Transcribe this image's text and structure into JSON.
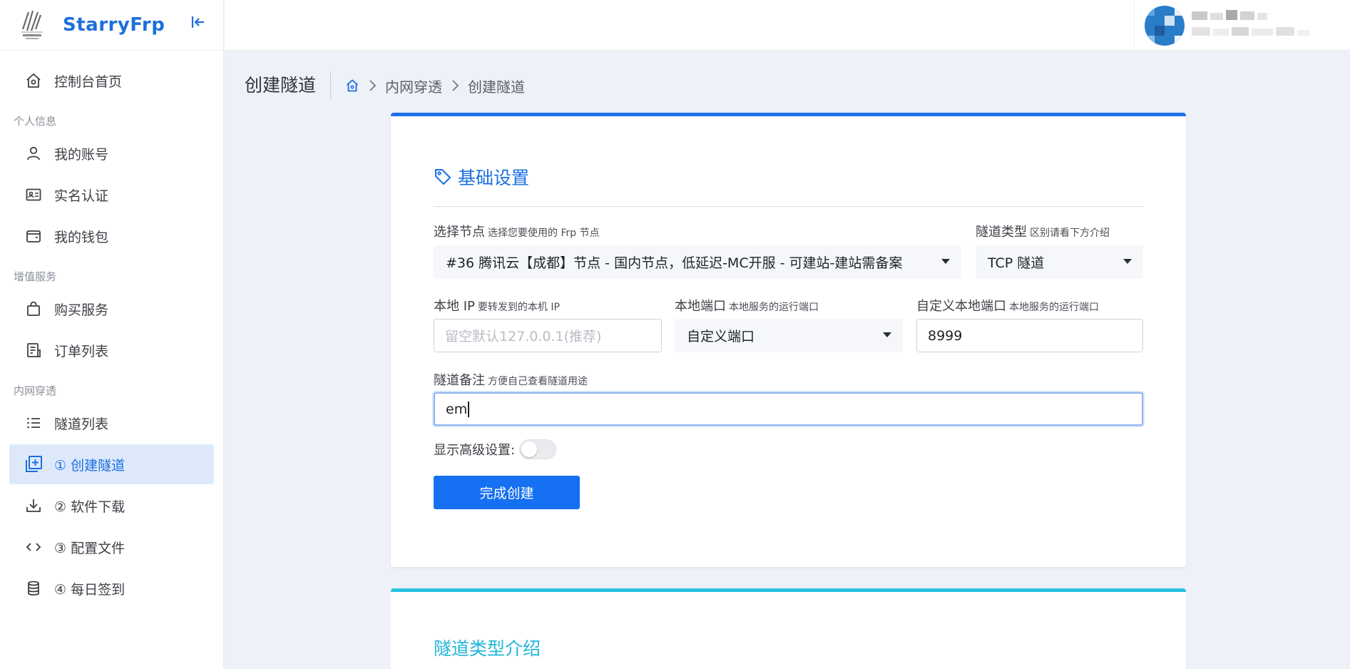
{
  "brand": {
    "name": "StarryFrp"
  },
  "sidebar": {
    "items": [
      {
        "label": "控制台首页",
        "icon": "home-icon"
      },
      {
        "section": "个人信息"
      },
      {
        "label": "我的账号",
        "icon": "user-icon"
      },
      {
        "label": "实名认证",
        "icon": "id-card-icon"
      },
      {
        "label": "我的钱包",
        "icon": "wallet-icon"
      },
      {
        "section": "增值服务"
      },
      {
        "label": "购买服务",
        "icon": "shopping-bag-icon"
      },
      {
        "label": "订单列表",
        "icon": "order-list-icon"
      },
      {
        "section": "内网穿透"
      },
      {
        "label": "隧道列表",
        "icon": "list-icon"
      },
      {
        "label": "① 创建隧道",
        "icon": "add-square-icon",
        "active": true
      },
      {
        "label": "② 软件下载",
        "icon": "download-icon"
      },
      {
        "label": "③ 配置文件",
        "icon": "code-icon"
      },
      {
        "label": "④ 每日签到",
        "icon": "database-icon"
      }
    ]
  },
  "header": {
    "user": {
      "name": "",
      "sub": ""
    }
  },
  "page": {
    "title": "创建隧道",
    "breadcrumb": [
      "内网穿透",
      "创建隧道"
    ]
  },
  "form": {
    "section_title": "基础设置",
    "node": {
      "label": "选择节点",
      "hint": "选择您要使用的 Frp 节点",
      "value": "#36 腾讯云【成都】节点 - 国内节点，低延迟-MC开服 - 可建站-建站需备案"
    },
    "tunnel_type": {
      "label": "隧道类型",
      "hint": "区别请看下方介绍",
      "value": "TCP 隧道"
    },
    "local_ip": {
      "label": "本地 IP",
      "hint": "要转发到的本机 IP",
      "placeholder": "留空默认127.0.0.1(推荐)"
    },
    "local_port": {
      "label": "本地端口",
      "hint": "本地服务的运行端口",
      "value": "自定义端口"
    },
    "custom_port": {
      "label": "自定义本地端口",
      "hint": "本地服务的运行端口",
      "value": "8999"
    },
    "remark": {
      "label": "隧道备注",
      "hint": "方便自己查看隧道用途",
      "value": "em"
    },
    "advanced": {
      "label": "显示高级设置:",
      "enabled": false
    },
    "submit_label": "完成创建"
  },
  "intro": {
    "title": "隧道类型介绍"
  },
  "colors": {
    "primary": "#1570f2",
    "accent_cyan": "#27c0e0",
    "active_bg": "#dde9fb"
  }
}
